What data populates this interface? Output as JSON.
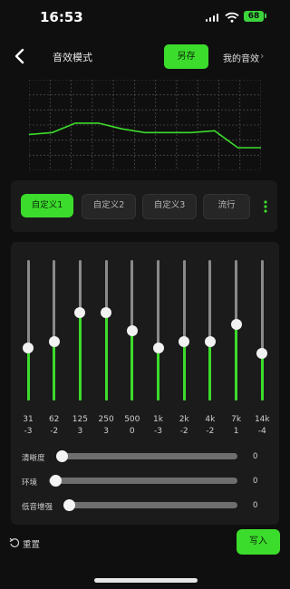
{
  "status": {
    "time": "16:53",
    "battery": "68"
  },
  "header": {
    "title": "音效模式",
    "save_as": "另存",
    "my_effects": "我的音效",
    "accent": "#3cdc2c"
  },
  "curve": {
    "values": [
      -2.5,
      -2,
      0.5,
      0.5,
      -1,
      -2,
      -2,
      -2,
      -1.5,
      -6,
      -6
    ],
    "range": [
      -12,
      12
    ]
  },
  "presets": [
    "自定义1",
    "自定义2",
    "自定义3",
    "流行"
  ],
  "eq": {
    "bands": [
      {
        "freq": "31",
        "gain": "-3",
        "level": -3
      },
      {
        "freq": "62",
        "gain": "-2",
        "level": -2
      },
      {
        "freq": "125",
        "gain": "3",
        "level": 3
      },
      {
        "freq": "250",
        "gain": "3",
        "level": 3
      },
      {
        "freq": "500",
        "gain": "0",
        "level": 0
      },
      {
        "freq": "1k",
        "gain": "-3",
        "level": -3
      },
      {
        "freq": "2k",
        "gain": "-2",
        "level": -2
      },
      {
        "freq": "4k",
        "gain": "-2",
        "level": -2
      },
      {
        "freq": "7k",
        "gain": "1",
        "level": 1
      },
      {
        "freq": "14k",
        "gain": "-4",
        "level": -4
      }
    ],
    "level_range": [
      -12,
      12
    ]
  },
  "sliders": [
    {
      "label": "清晰度",
      "value": "0"
    },
    {
      "label": "环境",
      "value": "0"
    },
    {
      "label": "低音增强",
      "value": "0"
    }
  ],
  "footer": {
    "reset": "重置",
    "write": "写入"
  }
}
